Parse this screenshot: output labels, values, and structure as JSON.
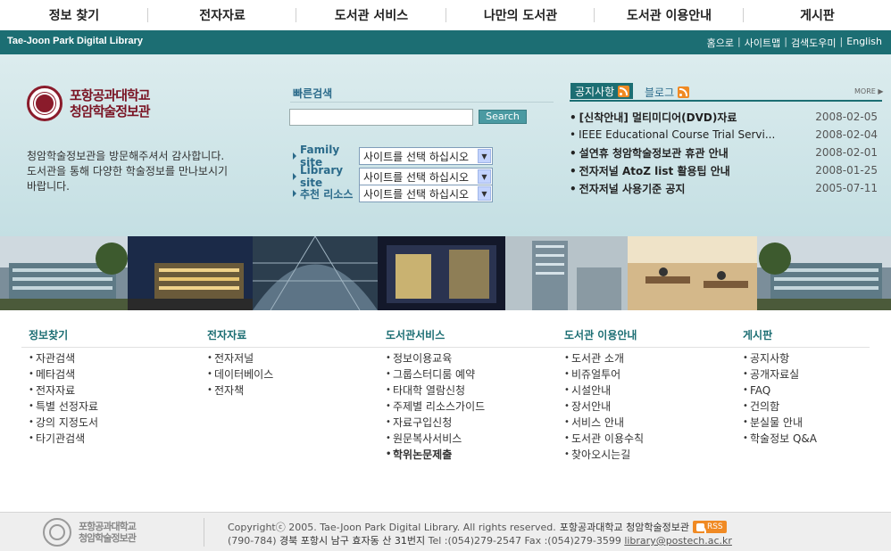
{
  "topnav": {
    "items": [
      "정보 찾기",
      "전자자료",
      "도서관 서비스",
      "나만의 도서관",
      "도서관 이용안내",
      "게시판"
    ]
  },
  "brandbar": {
    "title": "Tae-Joon Park Digital Library",
    "util": [
      "홈으로",
      "사이트맵",
      "검색도우미",
      "English"
    ]
  },
  "logo": {
    "line1": "포항공과대학교",
    "line2": "청암학술정보관"
  },
  "welcome": [
    "청암학술정보관을 방문해주셔서 감사합니다.",
    "도서관을 통해 다양한 학술정보를 만나보시기",
    "바랍니다."
  ],
  "quick_search": {
    "title": "빠른검색",
    "value": "",
    "button": "Search"
  },
  "site_selects": [
    {
      "label": "Family site",
      "value": "사이트를 선택 하십시오"
    },
    {
      "label": "Library site",
      "value": "사이트를 선택 하십시오"
    },
    {
      "label": "추천 리소스",
      "value": "사이트를 선택 하십시오"
    }
  ],
  "notices": {
    "tab": "공지사항",
    "blog": "블로그",
    "more": "MORE",
    "items": [
      {
        "title": "[신착안내] 멀티미디어(DVD)자료",
        "date": "2008-02-05",
        "bold": true
      },
      {
        "title": "IEEE Educational Course Trial Servi...",
        "date": "2008-02-04",
        "bold": false
      },
      {
        "title": "설연휴 청암학술정보관 휴관 안내",
        "date": "2008-02-01",
        "bold": true
      },
      {
        "title": "전자저널 AtoZ list 활용팁 안내",
        "date": "2008-01-25",
        "bold": true
      },
      {
        "title": "전자저널 사용기준 공지",
        "date": "2005-07-11",
        "bold": true
      }
    ]
  },
  "sitemap": [
    {
      "heading": "정보찾기",
      "items": [
        "자관검색",
        "메타검색",
        "전자자료",
        "특별 선정자료",
        "강의 지정도서",
        "타기관검색"
      ]
    },
    {
      "heading": "전자자료",
      "items": [
        "전자저널",
        "데이터베이스",
        "전자책"
      ]
    },
    {
      "heading": "도서관서비스",
      "items": [
        "정보이용교육",
        "그룹스터디룸 예약",
        "타대학 열람신청",
        "주제별 리소스가이드",
        "자료구입신청",
        "원문복사서비스",
        "학위논문제출"
      ]
    },
    {
      "heading": "도서관 이용안내",
      "items": [
        "도서관 소개",
        "비쥬얼투어",
        "시설안내",
        "장서안내",
        "서비스 안내",
        "도서관 이용수칙",
        "찾아오시는길"
      ]
    },
    {
      "heading": "게시판",
      "items": [
        "공지사항",
        "공개자료실",
        "FAQ",
        "건의함",
        "분실물 안내",
        "학술정보 Q&A"
      ]
    }
  ],
  "footer": {
    "logo_line1": "포항공과대학교",
    "logo_line2": "청암학술정보관",
    "copyright": "Copyrightⓒ 2005. Tae-Joon Park Digital Library. All rights reserved.",
    "copyright_ko": "포항공과대학교 청암학술정보관",
    "rss": "RSS",
    "postal": "(790-784)",
    "address": "경북 포항시 남구 효자동 산 31번지",
    "phone": "Tel :(054)279-2547 Fax :(054)279-3599",
    "email": "library@postech.ac.kr"
  },
  "colors": {
    "teal": "#1c6e73",
    "hero_bg": "#cfe5e8",
    "rss": "#f08a24",
    "logo_red": "#7a1424"
  }
}
